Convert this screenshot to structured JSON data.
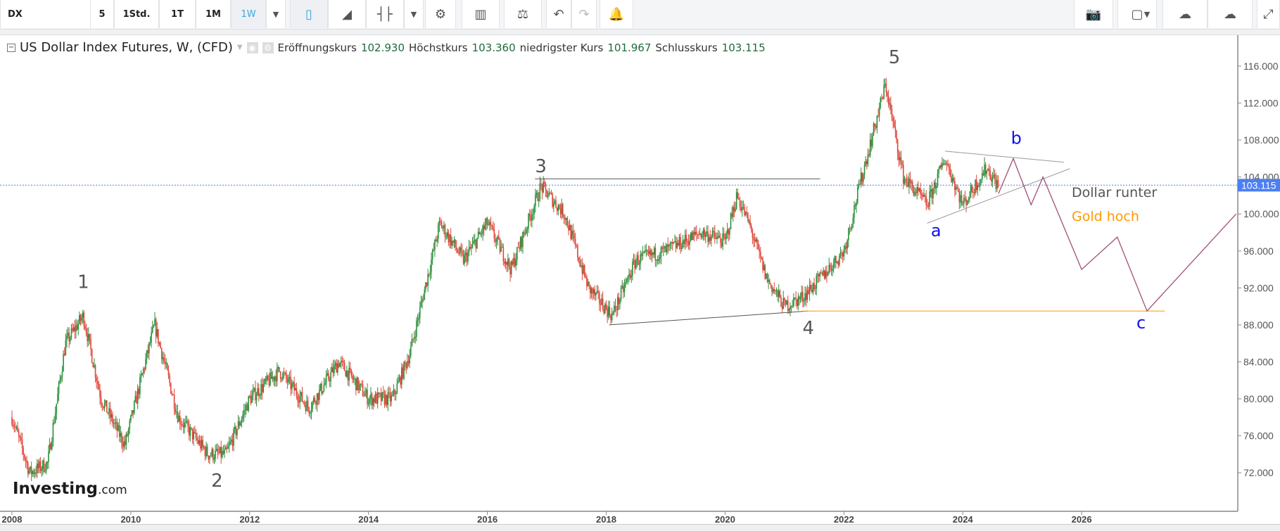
{
  "toolbar": {
    "symbol": "DX",
    "intervals": [
      "5",
      "1Std.",
      "1T",
      "1M",
      "1W"
    ],
    "active_interval": "1W",
    "icons": [
      "interval-dropdown-icon",
      "candlestick-icon",
      "area-chart-icon",
      "indicator-icon",
      "indicator-dropdown-icon",
      "gear-icon",
      "studies-icon",
      "compare-scale-icon",
      "undo-icon",
      "redo-icon",
      "alert-icon",
      "camera-icon",
      "rectangle-icon",
      "rectangle-dropdown-icon",
      "cloud-download-icon",
      "cloud-upload-icon",
      "fullscreen-icon"
    ]
  },
  "legend": {
    "title": "US Dollar Index Futures, W, (CFD)",
    "open_label": "Eröffnungskurs",
    "open": "102.930",
    "high_label": "Höchstkurs",
    "high": "103.360",
    "low_label": "niedrigster Kurs",
    "low": "101.967",
    "close_label": "Schlusskurs",
    "close": "103.115"
  },
  "watermark": {
    "brand": "Investing",
    "suffix": ".com"
  },
  "chart_data": {
    "type": "candlestick",
    "title": "US Dollar Index Futures, W, (CFD)",
    "ylim": [
      68,
      119
    ],
    "xlim": [
      2007.9,
      2029.0
    ],
    "y_ticks": [
      "72.000",
      "76.000",
      "80.000",
      "84.000",
      "88.000",
      "92.000",
      "96.000",
      "100.000",
      "104.000",
      "108.000",
      "112.000",
      "116.000"
    ],
    "x_ticks": [
      "2008",
      "2010",
      "2012",
      "2014",
      "2016",
      "2018",
      "2020",
      "2022",
      "2024",
      "2026"
    ],
    "current_price": "103.115",
    "price_path": [
      [
        2008.0,
        78
      ],
      [
        2008.3,
        72
      ],
      [
        2008.6,
        73
      ],
      [
        2008.9,
        86
      ],
      [
        2009.2,
        89
      ],
      [
        2009.5,
        80
      ],
      [
        2009.9,
        75
      ],
      [
        2010.4,
        88
      ],
      [
        2010.8,
        78
      ],
      [
        2011.3,
        74
      ],
      [
        2011.6,
        74
      ],
      [
        2012.0,
        80
      ],
      [
        2012.5,
        83
      ],
      [
        2013.0,
        79
      ],
      [
        2013.5,
        84
      ],
      [
        2014.0,
        80
      ],
      [
        2014.4,
        80
      ],
      [
        2014.7,
        85
      ],
      [
        2015.2,
        99
      ],
      [
        2015.6,
        95
      ],
      [
        2016.0,
        99
      ],
      [
        2016.4,
        94
      ],
      [
        2016.9,
        103
      ],
      [
        2017.3,
        100
      ],
      [
        2017.7,
        92
      ],
      [
        2018.1,
        89
      ],
      [
        2018.5,
        95
      ],
      [
        2019.0,
        96
      ],
      [
        2019.6,
        98
      ],
      [
        2020.0,
        97
      ],
      [
        2020.2,
        102
      ],
      [
        2020.4,
        99
      ],
      [
        2020.7,
        93
      ],
      [
        2021.0,
        90
      ],
      [
        2021.3,
        91
      ],
      [
        2021.6,
        93
      ],
      [
        2022.0,
        96
      ],
      [
        2022.3,
        104
      ],
      [
        2022.7,
        114
      ],
      [
        2023.0,
        104
      ],
      [
        2023.4,
        101
      ],
      [
        2023.7,
        106
      ],
      [
        2024.0,
        101
      ],
      [
        2024.4,
        105
      ],
      [
        2024.6,
        103
      ]
    ],
    "annotations": {
      "wave_labels": [
        {
          "text": "1",
          "x": 2009.2,
          "y": 92
        },
        {
          "text": "2",
          "x": 2011.45,
          "y": 70.5
        },
        {
          "text": "3",
          "x": 2016.9,
          "y": 104.5
        },
        {
          "text": "4",
          "x": 2021.4,
          "y": 87
        },
        {
          "text": "5",
          "x": 2022.85,
          "y": 116.3
        }
      ],
      "abc_labels": [
        {
          "text": "a",
          "x": 2023.55,
          "y": 97.6
        },
        {
          "text": "b",
          "x": 2024.9,
          "y": 107.6
        },
        {
          "text": "c",
          "x": 2027.0,
          "y": 87.6
        }
      ],
      "notes": [
        {
          "text": "Dollar runter",
          "color": "#555555"
        },
        {
          "text": "Gold hoch",
          "color": "#ff9900"
        }
      ],
      "resistance": [
        [
          2016.8,
          103.8
        ],
        [
          2021.6,
          103.8
        ]
      ],
      "support": [
        [
          2018.05,
          88
        ],
        [
          2021.4,
          89.5
        ]
      ],
      "gold_line": [
        [
          2021.3,
          89.5
        ],
        [
          2027.4,
          89.5
        ]
      ],
      "triangle_upper": [
        [
          2023.7,
          106.8
        ],
        [
          2025.7,
          105.6
        ]
      ],
      "triangle_lower": [
        [
          2023.4,
          99
        ],
        [
          2025.8,
          104.9
        ]
      ],
      "projection": [
        [
          2024.6,
          102.2
        ],
        [
          2024.85,
          106
        ],
        [
          2025.15,
          101
        ],
        [
          2025.35,
          104
        ],
        [
          2026.0,
          94
        ],
        [
          2026.6,
          97.5
        ],
        [
          2027.1,
          89.5
        ],
        [
          2028.6,
          100
        ]
      ]
    },
    "colors": {
      "up": "#2a8f3c",
      "down": "#e2453a",
      "projection": "#a0507a",
      "gold": "#ff9900",
      "label_blue": "#1010ee",
      "price_tag": "#4d7ff2"
    }
  }
}
